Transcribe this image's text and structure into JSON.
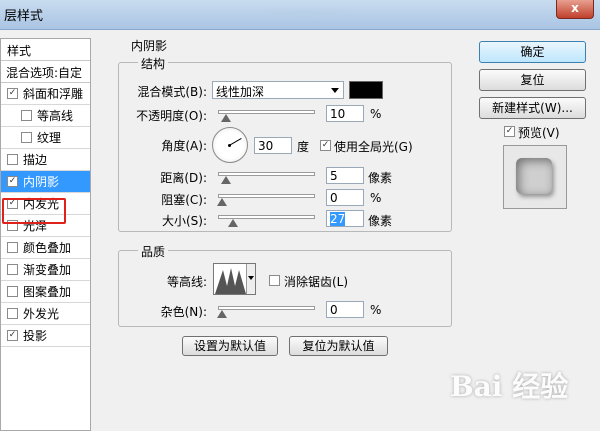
{
  "window": {
    "title": "层样式",
    "close_label": "x"
  },
  "styles_list": {
    "header": "样式",
    "blend_options": "混合选项:自定",
    "items": [
      {
        "label": "斜面和浮雕",
        "checked": true,
        "sub": false
      },
      {
        "label": "等高线",
        "checked": false,
        "sub": true
      },
      {
        "label": "纹理",
        "checked": false,
        "sub": true
      },
      {
        "label": "描边",
        "checked": false,
        "sub": false
      },
      {
        "label": "内阴影",
        "checked": true,
        "sub": false,
        "selected": true
      },
      {
        "label": "内发光",
        "checked": true,
        "sub": false
      },
      {
        "label": "光泽",
        "checked": false,
        "sub": false
      },
      {
        "label": "颜色叠加",
        "checked": false,
        "sub": false
      },
      {
        "label": "渐变叠加",
        "checked": false,
        "sub": false
      },
      {
        "label": "图案叠加",
        "checked": false,
        "sub": false
      },
      {
        "label": "外发光",
        "checked": false,
        "sub": false
      },
      {
        "label": "投影",
        "checked": true,
        "sub": false
      }
    ]
  },
  "panel": {
    "title": "内阴影",
    "structure": {
      "label": "结构",
      "blend_mode_label": "混合模式(B):",
      "blend_mode_value": "线性加深",
      "color": "#000000",
      "opacity_label": "不透明度(O):",
      "opacity_value": "10",
      "opacity_unit": "%",
      "angle_label": "角度(A):",
      "angle_value": "30",
      "angle_unit": "度",
      "global_light_label": "使用全局光(G)",
      "global_light_checked": true,
      "distance_label": "距离(D):",
      "distance_value": "5",
      "distance_unit": "像素",
      "choke_label": "阻塞(C):",
      "choke_value": "0",
      "choke_unit": "%",
      "size_label": "大小(S):",
      "size_value": "27",
      "size_unit": "像素"
    },
    "quality": {
      "label": "品质",
      "contour_label": "等高线:",
      "anti_alias_label": "消除锯齿(L)",
      "anti_alias_checked": false,
      "noise_label": "杂色(N):",
      "noise_value": "0",
      "noise_unit": "%"
    },
    "make_default": "设置为默认值",
    "reset_default": "复位为默认值"
  },
  "right": {
    "ok": "确定",
    "reset": "复位",
    "new_style": "新建样式(W)...",
    "preview_label": "预览(V)",
    "preview_checked": true
  },
  "watermark": "Bai 经验"
}
